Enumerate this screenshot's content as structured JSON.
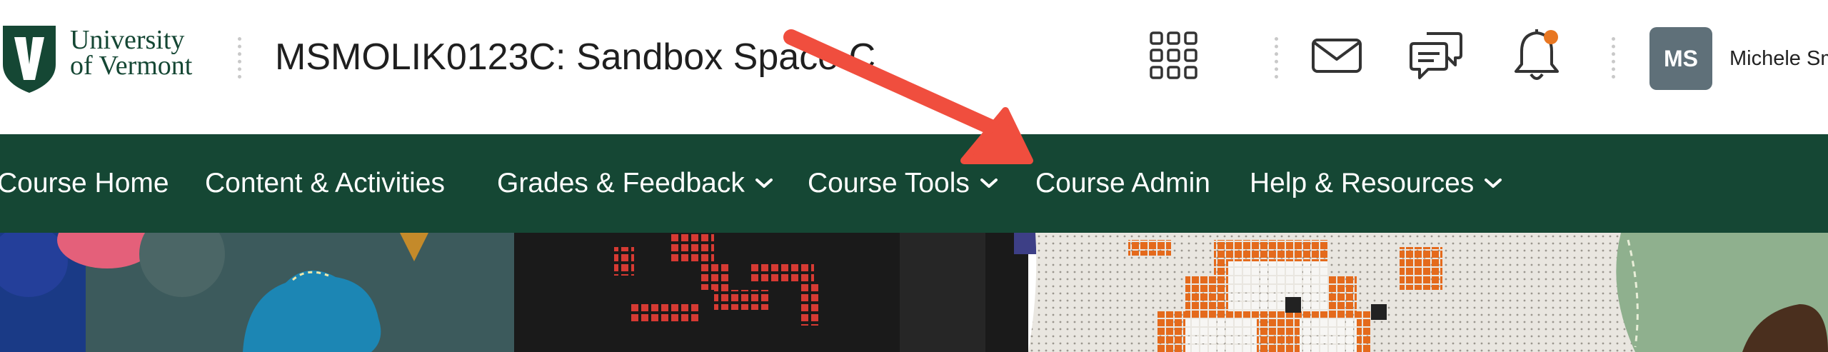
{
  "logo": {
    "lines": [
      "University",
      "of Vermont"
    ]
  },
  "header": {
    "course_title": "MSMOLIK0123C: Sandbox Space C",
    "icons": [
      "apps-grid-icon",
      "mail-icon",
      "chat-icon",
      "bell-icon"
    ],
    "user": {
      "initials": "MS",
      "name": "Michele Sm"
    }
  },
  "nav": {
    "items": [
      {
        "label": "Course Home",
        "dropdown": false
      },
      {
        "label": "Content & Activities",
        "dropdown": false
      },
      {
        "label": "Grades & Feedback",
        "dropdown": true
      },
      {
        "label": "Course Tools",
        "dropdown": true
      },
      {
        "label": "Course Admin",
        "dropdown": false
      },
      {
        "label": "Help & Resources",
        "dropdown": true
      }
    ]
  },
  "colors": {
    "brand_green": "#154734",
    "notification": "#e87722",
    "arrow": "#f04e3e",
    "avatar_bg": "#5f7079"
  },
  "annotation": {
    "type": "arrow",
    "points_to": "Course Admin"
  }
}
